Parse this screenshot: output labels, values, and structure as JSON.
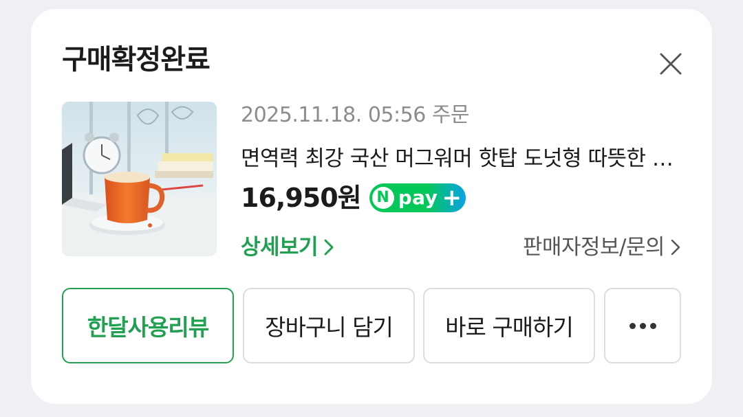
{
  "card": {
    "title": "구매확정완료",
    "close_icon": "close-icon"
  },
  "order": {
    "date": "2025.11.18. 05:56 주문",
    "product_name": "면역력 최강 국산 머그워머 핫탑 도넛형 따뜻한 컵받침",
    "price": "16,950원",
    "npay_badge": {
      "letter": "N",
      "text": "pay",
      "plus": "+"
    },
    "detail_link": "상세보기",
    "seller_link": "판매자정보/문의"
  },
  "actions": {
    "review": "한달사용리뷰",
    "cart": "장바구니 담기",
    "buy": "바로 구매하기",
    "more_icon": "more-dots-icon"
  },
  "colors": {
    "accent_green": "#20a050",
    "npay_green": "#04c75a",
    "npay_blue": "#0aa3e6",
    "text_dark": "#1b1b1b",
    "text_gray": "#8c8c8c"
  }
}
